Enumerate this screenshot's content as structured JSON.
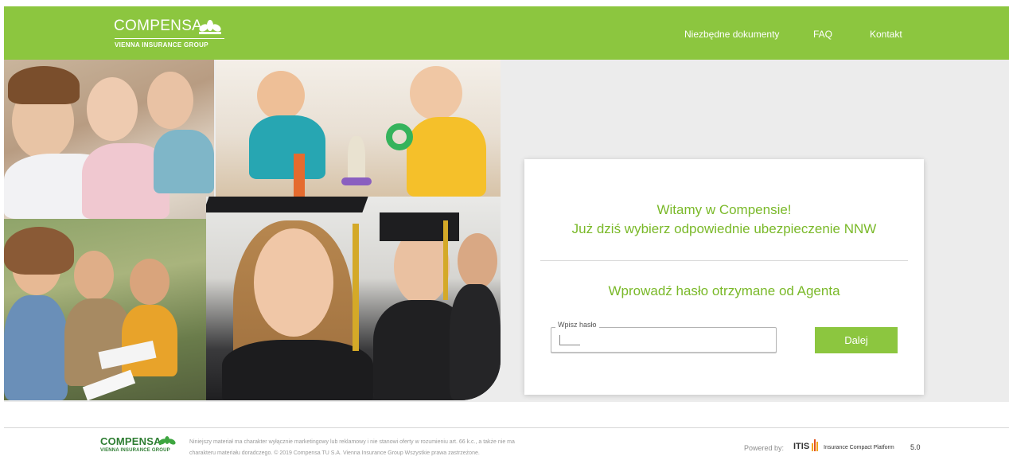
{
  "header": {
    "logo_word": "COMPENSA",
    "logo_sub": "VIENNA INSURANCE GROUP",
    "nav": {
      "documents": "Niezbędne dokumenty",
      "faq": "FAQ",
      "contact": "Kontakt"
    },
    "brand_color": "#8cc63f"
  },
  "card": {
    "welcome_line1": "Witamy w Compensie!",
    "welcome_line2": "Już dziś wybierz odpowiednie ubezpieczenie NNW",
    "prompt": "Wprowadź hasło otrzymane od Agenta",
    "password_label": "Wpisz hasło",
    "password_value": "",
    "submit_label": "Dalej",
    "text_color": "#7ab929"
  },
  "footer": {
    "logo_word": "COMPENSA",
    "logo_sub": "VIENNA INSURANCE GROUP",
    "legal_line1": "Niniejszy materiał ma charakter wyłącznie marketingowy lub reklamowy i nie stanowi oferty w rozumieniu art. 66 k.c., a także nie ma",
    "legal_line2": "charakteru materiału doradczego. © 2019 Compensa TU S.A. Vienna Insurance Group Wszystkie prawa zastrzeżone.",
    "powered_by": "Powered by:",
    "itis": "ITIS",
    "platform": "Insurance Compact Platform",
    "version": "5.0"
  }
}
